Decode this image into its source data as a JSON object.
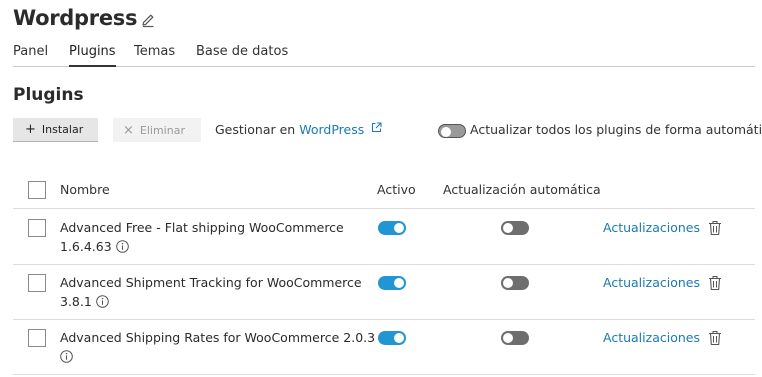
{
  "app_title": "Wordpress",
  "tabs": [
    {
      "label": "Panel",
      "active": false
    },
    {
      "label": "Plugins",
      "active": true
    },
    {
      "label": "Temas",
      "active": false
    },
    {
      "label": "Base de datos",
      "active": false
    }
  ],
  "section_title": "Plugins",
  "toolbar": {
    "install_label": "Instalar",
    "install_icon": "plus-icon",
    "delete_label": "Eliminar",
    "delete_icon": "close-icon",
    "manage_prefix": "Gestionar en",
    "manage_link": "WordPress",
    "auto_update_all_label": "Actualizar todos los plugins de forma automática",
    "auto_update_all_on": false
  },
  "table": {
    "columns": [
      "Nombre",
      "Activo",
      "Actualización automática"
    ],
    "rows": [
      {
        "name": "Advanced Free - Flat shipping WooCommerce",
        "version": "1.6.4.63",
        "active": true,
        "auto_update": false,
        "updates_label": "Actualizaciones"
      },
      {
        "name": "Advanced Shipment Tracking for WooCommerce",
        "version": "3.8.1",
        "active": true,
        "auto_update": false,
        "updates_label": "Actualizaciones"
      },
      {
        "name": "Advanced Shipping Rates for WooCommerce 2.0.3",
        "version": "",
        "active": true,
        "auto_update": false,
        "updates_label": "Actualizaciones"
      }
    ]
  },
  "colors": {
    "accent": "#2196d3",
    "link": "#1a7ab3",
    "toggle_off": "#6e6e6e"
  }
}
